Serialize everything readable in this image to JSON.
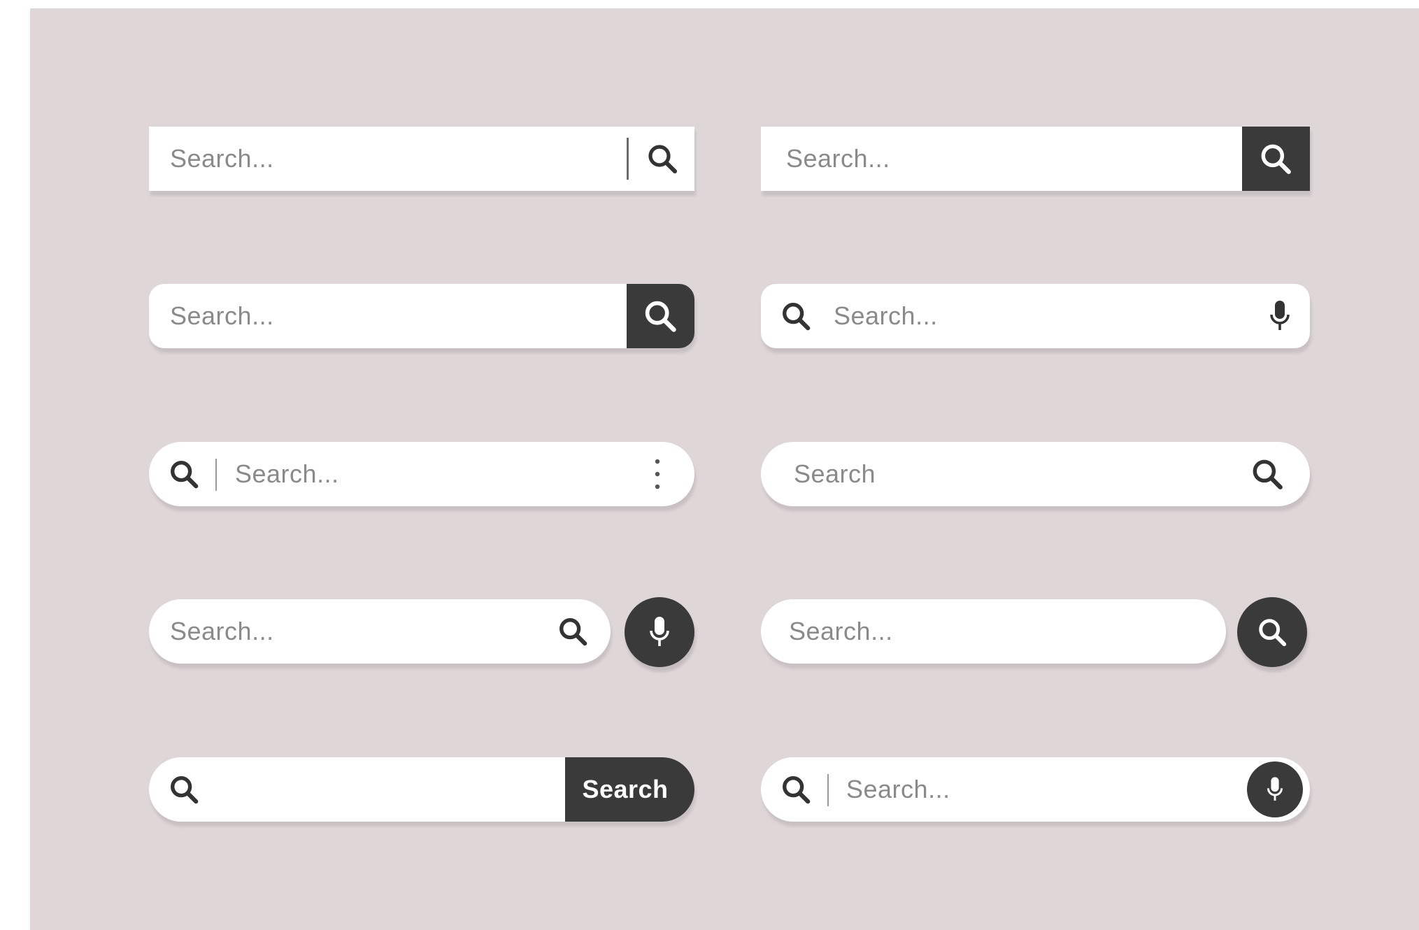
{
  "colors": {
    "background": "#dfd6d8",
    "bar": "#ffffff",
    "dark": "#3a3a3a",
    "placeholder": "#8a8a8a"
  },
  "bars": [
    {
      "placeholder": "Search...",
      "icons": [
        "search-icon"
      ]
    },
    {
      "placeholder": "Search...",
      "icons": [
        "search-icon"
      ]
    },
    {
      "placeholder": "Search...",
      "icons": [
        "search-icon"
      ]
    },
    {
      "placeholder": "Search...",
      "icons": [
        "search-icon",
        "microphone-icon"
      ]
    },
    {
      "placeholder": "Search...",
      "icons": [
        "search-icon",
        "more-vertical-icon"
      ]
    },
    {
      "placeholder": "Search",
      "icons": [
        "search-icon"
      ]
    },
    {
      "placeholder": "Search...",
      "icons": [
        "search-icon",
        "microphone-icon"
      ]
    },
    {
      "placeholder": "Search...",
      "icons": [
        "search-icon"
      ]
    },
    {
      "placeholder": "",
      "button_label": "Search",
      "icons": [
        "search-icon"
      ]
    },
    {
      "placeholder": "Search...",
      "icons": [
        "search-icon",
        "microphone-icon"
      ]
    }
  ]
}
